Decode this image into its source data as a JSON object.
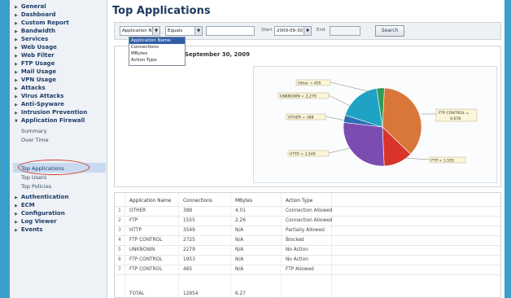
{
  "sidebar": {
    "top_items": [
      "General",
      "Dashboard",
      "Custom Report",
      "Bandwidth",
      "Services",
      "Web Usage",
      "Web Filter",
      "FTP Usage",
      "Mail Usage",
      "VPN Usage",
      "Attacks",
      "Virus Attacks",
      "Anti-Spyware",
      "Intrusion Prevention"
    ],
    "expanded_item": "Application Firewall",
    "sub_items": [
      "Summary",
      "Over Time",
      "Top Applications",
      "Top Users",
      "Top Policies"
    ],
    "selected_sub": "Top Applications",
    "bottom_items": [
      "Authentication",
      "ECM",
      "Configuration",
      "Log Viewer",
      "Events"
    ]
  },
  "page": {
    "title": "Top Applications"
  },
  "filter": {
    "field_value": "Application N",
    "operator_value": "Equals",
    "start_label": "Start",
    "start_value": "2009-09-30",
    "end_label": "End",
    "search_label": "Search",
    "dropdown_options": [
      "Application Name",
      "Connections",
      "MBytes",
      "Action Type"
    ]
  },
  "chart_section": {
    "title": "r September 30, 2009"
  },
  "chart_data": {
    "type": "pie",
    "slices": [
      {
        "label": "FTP CONTROL = 4,678",
        "value": 4678,
        "color": "#d9763a"
      },
      {
        "label": "FTP = 1,555",
        "value": 1555,
        "color": "#d8342b"
      },
      {
        "label": "HTTP = 3,549",
        "value": 3549,
        "color": "#7c4db0"
      },
      {
        "label": "OTHER = 388",
        "value": 388,
        "color": "#2b6fb4"
      },
      {
        "label": "UNKNOWN = 2,279",
        "value": 2279,
        "color": "#1fa3c4"
      },
      {
        "label": "Other = 405",
        "value": 405,
        "color": "#2f9a55"
      }
    ],
    "legend_labels": [
      "Other = 405",
      "UNKNOWN = 2,279",
      "OTHER = 388",
      "HTTP = 3,549",
      "FTP = 1,555",
      "FTP CONTROL =",
      "4,678"
    ]
  },
  "table": {
    "columns": [
      "Application Name",
      "Connections",
      "MBytes",
      "Action Type"
    ],
    "rows": [
      [
        "1",
        "OTHER",
        "388",
        "4.01",
        "Connection Allowed"
      ],
      [
        "2",
        "FTP",
        "1555",
        "2.26",
        "Connection Allowed"
      ],
      [
        "3",
        "HTTP",
        "3549",
        "N/A",
        "Partially Allowed"
      ],
      [
        "4",
        "FTP CONTROL",
        "2725",
        "N/A",
        "Blocked"
      ],
      [
        "5",
        "UNKNOWN",
        "2279",
        "N/A",
        "No Action"
      ],
      [
        "6",
        "FTP CONTROL",
        "1953",
        "N/A",
        "No Action"
      ],
      [
        "7",
        "FTP CONTROL",
        "485",
        "N/A",
        "FTP Allowed"
      ]
    ],
    "total": [
      "TOTAL",
      "12854",
      "6.27"
    ]
  }
}
